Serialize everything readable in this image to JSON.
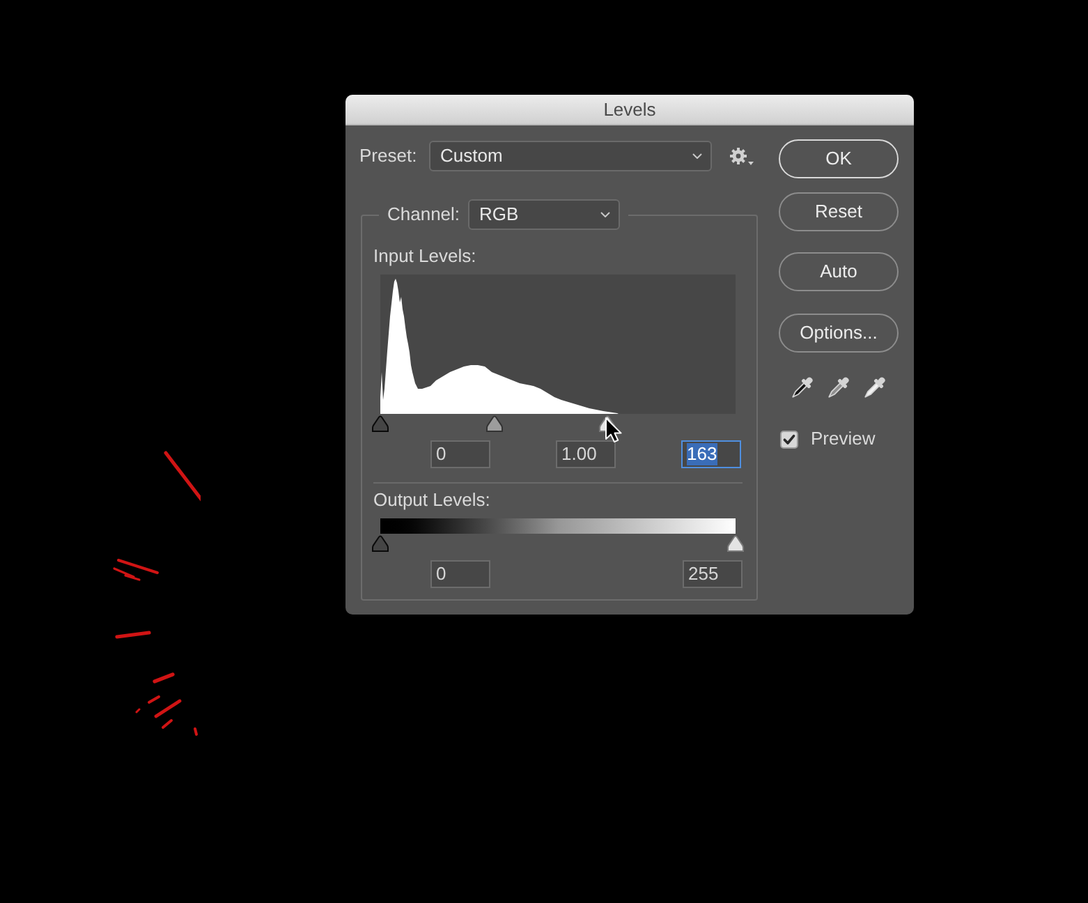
{
  "dialog": {
    "title": "Levels",
    "preset": {
      "label": "Preset:",
      "value": "Custom"
    },
    "channel": {
      "label": "Channel:",
      "value": "RGB"
    },
    "input_levels": {
      "label": "Input Levels:",
      "sliders": [
        {
          "kind": "shadow",
          "level": 0
        },
        {
          "kind": "midtone",
          "level": 0.32
        },
        {
          "kind": "highlight",
          "level": 0.639
        }
      ],
      "fields": [
        {
          "value": "0",
          "selected": false
        },
        {
          "value": "1.00",
          "selected": false
        },
        {
          "value": "163",
          "selected": true
        }
      ]
    },
    "output_levels": {
      "label": "Output Levels:",
      "sliders": [
        {
          "kind": "shadow",
          "level": 0
        },
        {
          "kind": "highlight",
          "level": 1
        }
      ],
      "fields": [
        {
          "value": "0",
          "selected": false
        },
        {
          "value": "255",
          "selected": false
        }
      ]
    },
    "buttons": [
      {
        "label": "OK",
        "default": true
      },
      {
        "label": "Reset",
        "default": false
      },
      {
        "label": "Auto",
        "default": false
      },
      {
        "label": "Options...",
        "default": false
      }
    ],
    "preview": {
      "label": "Preview",
      "checked": true
    }
  }
}
